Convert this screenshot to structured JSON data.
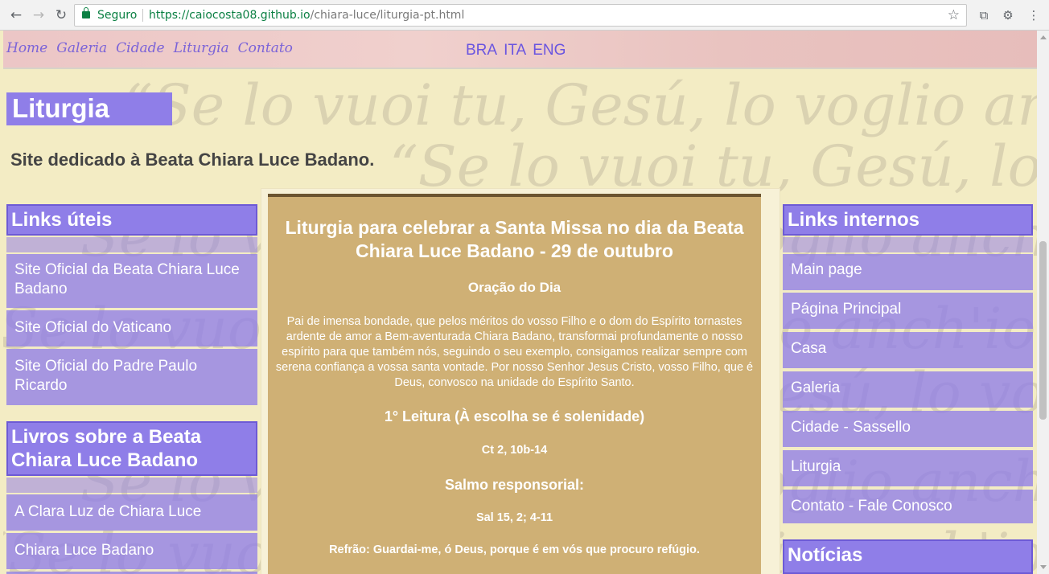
{
  "browser": {
    "secure_label": "Seguro",
    "url_scheme": "https://",
    "url_domain": "caiocosta08.github.io",
    "url_path": "/chiara-luce/liturgia-pt.html"
  },
  "nav": {
    "items": [
      "Home",
      "Galeria",
      "Cidade",
      "Liturgia",
      "Contato"
    ],
    "languages": [
      "BRA",
      "ITA",
      "ENG"
    ]
  },
  "page": {
    "title": "Liturgia",
    "subtitle": "Site dedicado à Beata Chiara Luce Badano.",
    "background_quote": "“Se lo vuoi tu, Gesú, lo voglio anch'io!”"
  },
  "left": {
    "useful_links": {
      "heading": "Links úteis",
      "items": [
        "Site Oficial da Beata Chiara Luce Badano",
        "Site Oficial do Vaticano",
        "Site Oficial do Padre Paulo Ricardo"
      ]
    },
    "books": {
      "heading": "Livros sobre a Beata Chiara Luce Badano",
      "items": [
        "A Clara Luz de Chiara Luce",
        "Chiara Luce Badano"
      ]
    }
  },
  "center": {
    "title": "Liturgia para celebrar a Santa Missa no dia da Beata Chiara Luce Badano - 29 de outubro",
    "prayer_heading": "Oração do Dia",
    "prayer_text": "Pai de imensa bondade, que pelos méritos do vosso Filho e o dom do Espírito tornastes ardente de amor a Bem-aventurada Chiara Badano, transformai profundamente o nosso espírito para que também nós, seguindo o seu exemplo, consigamos realizar sempre com serena confiança a vossa santa vontade. Por nosso Senhor Jesus Cristo, vosso Filho, que é Deus, convosco na unidade do Espírito Santo.",
    "reading1_heading": "1° Leitura (À escolha se é solenidade)",
    "reading1_ref": "Ct 2, 10b-14",
    "psalm_heading": "Salmo responsorial:",
    "psalm_ref": "Sal 15, 2; 4-11",
    "refrain": "Refrão: Guardai-me, ó Deus, porque é em vós que procuro refúgio."
  },
  "right": {
    "internal_links": {
      "heading": "Links internos",
      "items": [
        "Main page",
        "Página Principal",
        "Casa",
        "Galeria",
        "Cidade - Sassello",
        "Liturgia",
        "Contato - Fale Conosco"
      ]
    },
    "news": {
      "heading": "Notícias"
    }
  },
  "colors": {
    "accent": "#8f7ee8",
    "page_bg": "#f3ecc4",
    "center_bg": "#cfb075",
    "secure_green": "#0b8043"
  }
}
